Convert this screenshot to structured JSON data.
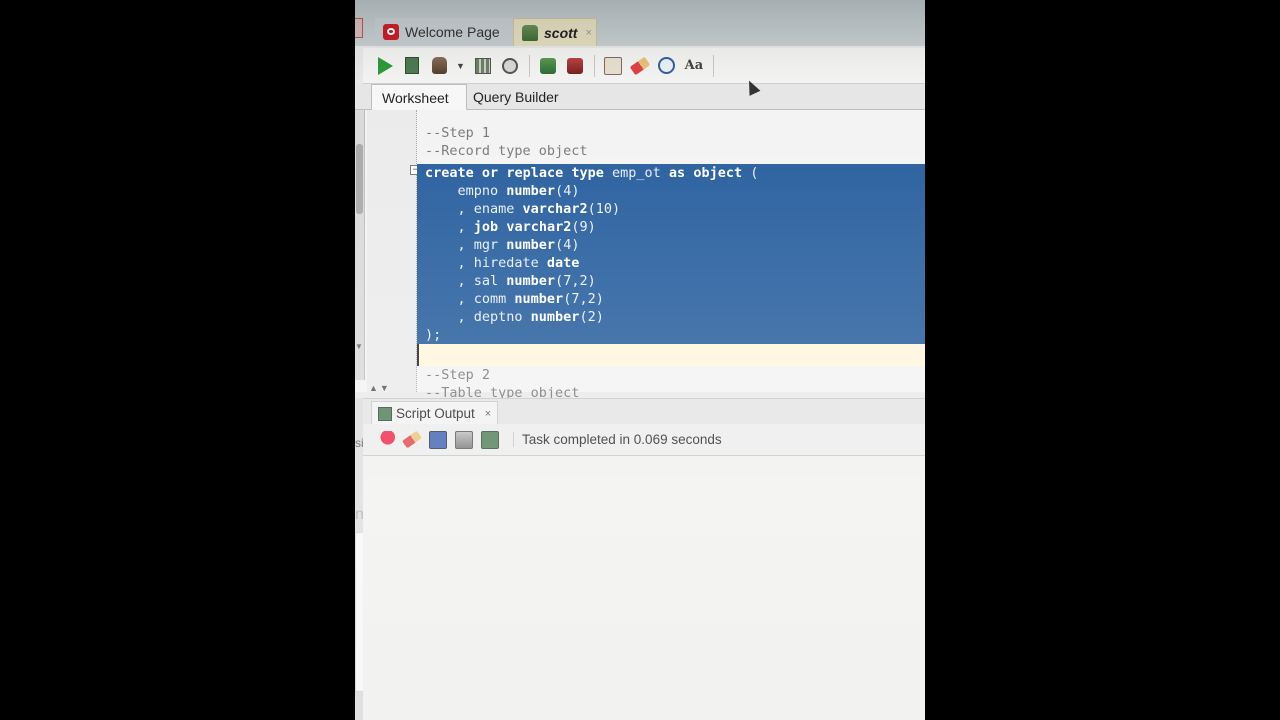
{
  "tabs": {
    "welcome": {
      "label": "Welcome Page",
      "icon": "oracle-icon"
    },
    "scott": {
      "label": "scott",
      "icon": "database-connection-icon",
      "close": "×"
    }
  },
  "toolbar": {
    "buttons": [
      "run-statement-icon",
      "run-script-icon",
      "autotrace-icon",
      "explain-plan-icon",
      "sql-tuning-icon",
      "commit-icon",
      "rollback-icon",
      "sql-icon",
      "clear-icon",
      "history-icon",
      "format-icon"
    ],
    "format_glyph": "Aa"
  },
  "subtabs": {
    "worksheet": "Worksheet",
    "query_builder": "Query Builder"
  },
  "editor": {
    "lines": [
      "--Step 1",
      "--Record type object",
      "create or replace type emp_ot as object (",
      "    empno number(4)",
      "    , ename varchar2(10)",
      "    , job varchar2(9)",
      "    , mgr number(4)",
      "    , hiredate date",
      "    , sal number(7,2)",
      "    , comm number(7,2)",
      "    , deptno number(2)",
      ");",
      "",
      "--Step 2",
      "--Table type object"
    ],
    "fold_marker": "−"
  },
  "output": {
    "tab_label": "Script Output",
    "close": "×",
    "status": "Task completed in 0.069 seconds"
  },
  "left_dock": {
    "label1": "sit",
    "label2": "ng"
  },
  "colors": {
    "selection": "#265d9d",
    "tab_active": "#e4dec0",
    "run_green": "#2f9a3b"
  }
}
